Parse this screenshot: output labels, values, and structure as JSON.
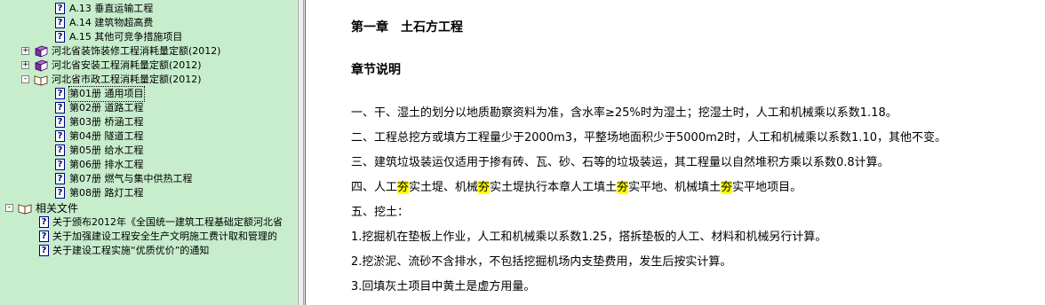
{
  "tree": {
    "items": [
      {
        "label": "A.13 垂直运输工程"
      },
      {
        "label": "A.14 建筑物超高费"
      },
      {
        "label": "A.15 其他可竞争措施项目"
      },
      {
        "label": "河北省装饰装修工程消耗量定额(2012)",
        "toggle": "+"
      },
      {
        "label": "河北省安装工程消耗量定额(2012)",
        "toggle": "+"
      },
      {
        "label": "河北省市政工程消耗量定额(2012)",
        "toggle": "-"
      },
      {
        "label": "第01册 通用项目"
      },
      {
        "label": "第02册 道路工程"
      },
      {
        "label": "第03册 桥涵工程"
      },
      {
        "label": "第04册 隧道工程"
      },
      {
        "label": "第05册 给水工程"
      },
      {
        "label": "第06册 排水工程"
      },
      {
        "label": "第07册 燃气与集中供热工程"
      },
      {
        "label": "第08册 路灯工程"
      },
      {
        "label": "相关文件",
        "toggle": "-"
      },
      {
        "label": "关于颁布2012年《全国统一建筑工程基础定额河北省"
      },
      {
        "label": "关于加强建设工程安全生产文明施工费计取和管理的"
      },
      {
        "label": "关于建设工程实施“优质优价”的通知"
      }
    ]
  },
  "doc": {
    "chapter_title": "第一章　土石方工程",
    "section_title": "章节说明",
    "p1": "一、干、湿土的划分以地质勘察资料为准，含水率≥25%时为湿土；挖湿土时，人工和机械乘以系数1.18。",
    "p2": "二、工程总挖方或填方工程量少于2000m3，平整场地面积少于5000m2时，人工和机械乘以系数1.10，其他不变。",
    "p3": "三、建筑垃圾装运仅适用于掺有砖、瓦、砂、石等的垃圾装运，其工程量以自然堆积方乘以系数0.8计算。",
    "p4": {
      "s1": "四、人工",
      "h1": "夯",
      "s2": "实土堤、机械",
      "h2": "夯",
      "s3": "实土堤执行本章人工填土",
      "h3": "夯",
      "s4": "实平地、机械填土",
      "h4": "夯",
      "s5": "实平地项目。"
    },
    "p5": "五、挖土：",
    "p6": "1.挖掘机在垫板上作业，人工和机械乘以系数1.25，搭拆垫板的人工、材料和机械另行计算。",
    "p7": "2.挖淤泥、流砂不含排水，不包括挖掘机场内支垫费用，发生后按实计算。",
    "p8": "3.回填灰土项目中黄土是虚方用量。"
  },
  "colors": {
    "tree_bg": "#c7edcc",
    "highlight": "#ffff00"
  }
}
